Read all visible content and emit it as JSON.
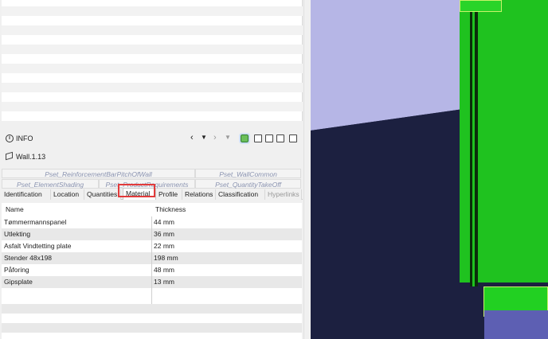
{
  "info_panel": {
    "title": "INFO",
    "entity": "Wall.1.13"
  },
  "psets": {
    "row1": [
      "Pset_ReinforcementBarPitchOfWall",
      "Pset_WallCommon"
    ],
    "row2": [
      "Pset_ElementShading",
      "Pset_ProductRequirements",
      "Pset_QuantityTakeOff"
    ]
  },
  "tabs": [
    "Identification",
    "Location",
    "Quantities",
    "Material",
    "Profile",
    "Relations",
    "Classification",
    "Hyperlinks"
  ],
  "selected_tab": "Material",
  "table": {
    "columns": [
      "Name",
      "Thickness"
    ],
    "rows": [
      [
        "Tømmermannspanel",
        "44 mm"
      ],
      [
        "Utlekting",
        "36 mm"
      ],
      [
        "Asfalt Vindtetting plate",
        "22 mm"
      ],
      [
        "Stender 48x198",
        "198 mm"
      ],
      [
        "Påforing",
        "48 mm"
      ],
      [
        "Gipsplate",
        "13 mm"
      ]
    ]
  },
  "colors": {
    "highlight": "#e23b3b",
    "wall": "#1fc21f",
    "sky": "#b6b6e6",
    "ground": "#1c2040"
  },
  "icons": [
    "info-icon",
    "chevron-left-icon",
    "triangle-down-icon",
    "chevron-right-icon",
    "triangle-down-icon",
    "tree-icon",
    "clipboard-icon",
    "window-icon",
    "cube-icon"
  ]
}
